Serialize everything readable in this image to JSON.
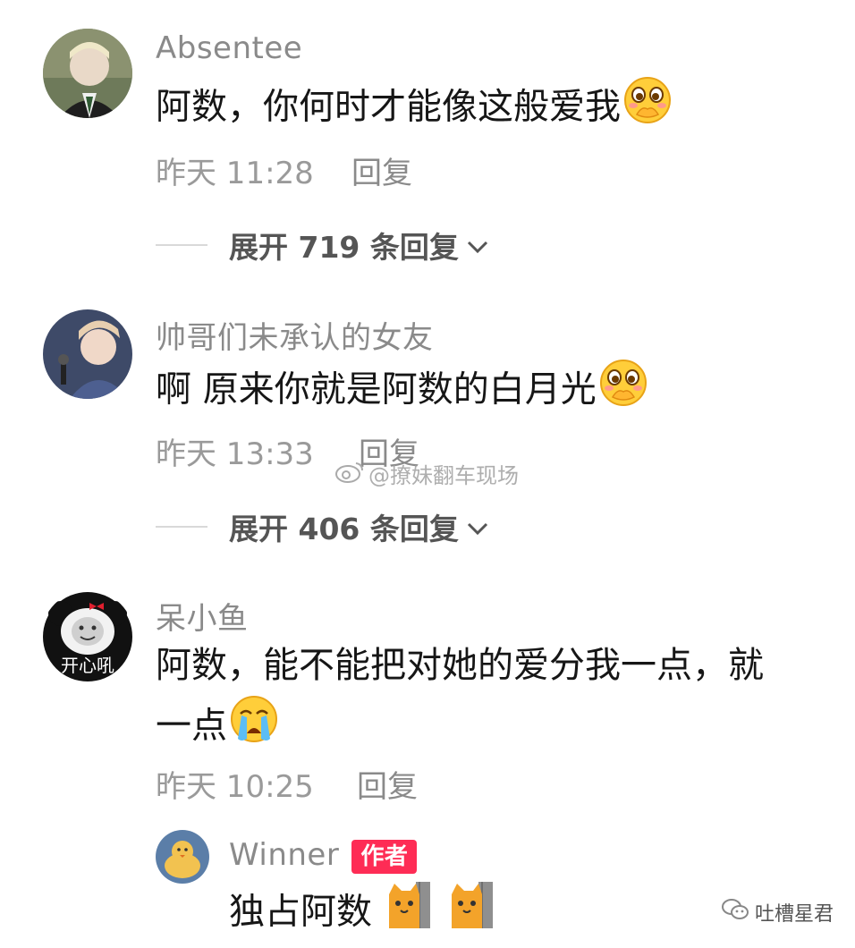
{
  "comments": [
    {
      "username": "Absentee",
      "text": "阿数，你何时才能像这般爱我",
      "time": "昨天 11:28",
      "reply": "回复",
      "expand": "展开 719 条回复",
      "emoji": "shy-face-emoji"
    },
    {
      "username": "帅哥们未承认的女友",
      "text": "啊 原来你就是阿数的白月光",
      "time": "昨天 13:33",
      "reply": "回复",
      "expand": "展开 406 条回复",
      "emoji": "shy-face-emoji"
    },
    {
      "username": "呆小鱼",
      "text_line1": "阿数，能不能把对她的爱分我一点，就",
      "text_line2": "一点",
      "time": "昨天 10:25",
      "reply": "回复",
      "avatar_text": "开心吼",
      "emoji": "crying-face-emoji",
      "sub_reply": {
        "username": "Winner",
        "tag": "作者",
        "text": "独占阿数",
        "emoji": "cat-peeking-emoji"
      }
    }
  ],
  "watermark": "@撩妹翻车现场",
  "brand": "吐槽星君",
  "colors": {
    "author_tag": "#fe2c55",
    "username": "#8a8a8a",
    "text": "#161616",
    "meta": "#9a9a9a"
  }
}
